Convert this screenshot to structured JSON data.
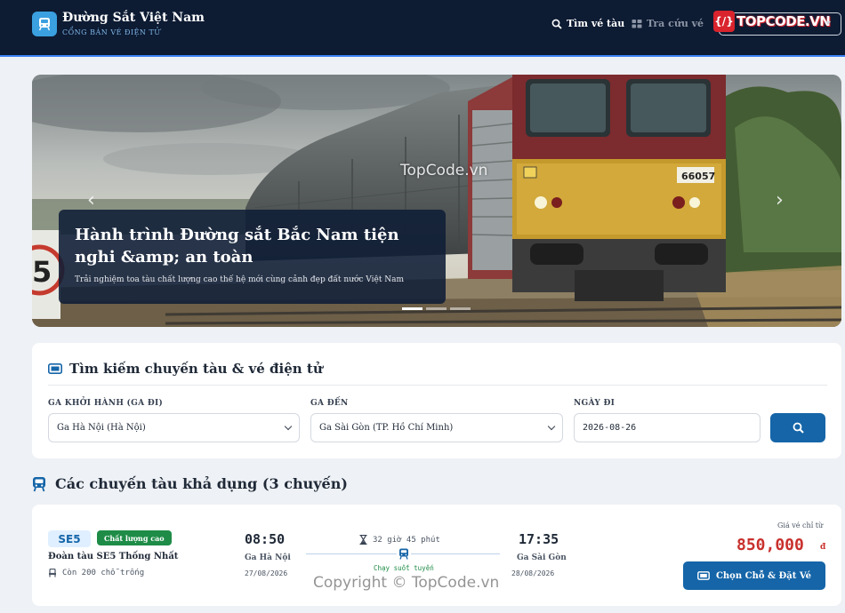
{
  "header": {
    "brand_name": "Đường Sắt Việt Nam",
    "brand_sub": "CỔNG BÁN VÉ ĐIỆN TỬ",
    "nav_search": "Tìm vé tàu",
    "nav_lookup": "Tra cứu vé",
    "watermark_logo_text": "TOPCODE.VN",
    "watermark_logo_mark": "{/}"
  },
  "hero": {
    "title": "Hành trình Đường sắt Bắc Nam tiện nghi &amp; an toàn",
    "subtitle": "Trải nghiệm toa tàu chất lượng cao thế hệ mới cùng cảnh đẹp đất nước Việt Nam",
    "prev_arrow": "‹",
    "next_arrow": "›",
    "locomotive_number": "66057",
    "watermark": "TopCode.vn",
    "slides": 3,
    "active_slide": 1
  },
  "search": {
    "title": "Tìm kiếm chuyến tàu & vé điện tử",
    "from_label": "GA KHỞI HÀNH (GA ĐI)",
    "from_value": "Ga Hà Nội (Hà Nội)",
    "to_label": "GA ĐẾN",
    "to_value": "Ga Sài Gòn (TP. Hồ Chí Minh)",
    "date_label": "NGÀY ĐI",
    "date_value": "2026-08-26"
  },
  "results": {
    "title": "Các chuyến tàu khả dụng (3 chuyến)",
    "trips": [
      {
        "code": "SE5",
        "quality": "Chất lượng cao",
        "name": "Đoàn tàu SE5 Thống Nhất",
        "seats": "Còn 200 chỗ trống",
        "depart_time": "08:50",
        "depart_station": "Ga Hà Nội",
        "depart_date": "27/08/2026",
        "duration": "32 giờ 45 phút",
        "route_note": "Chạy suốt tuyến",
        "arrive_time": "17:35",
        "arrive_station": "Ga Sài Gòn",
        "arrive_date": "28/08/2026",
        "price_label": "Giá vé chỉ từ",
        "price": "850,000",
        "currency": "đ",
        "book_label": "Chọn Chỗ & Đặt Vé"
      }
    ]
  },
  "footer": {
    "copyright": "Copyright © TopCode.vn"
  },
  "colors": {
    "header_bg": "#0d1b33",
    "accent": "#1565a8",
    "badge_green": "#1e8c47",
    "price_red": "#c9302c"
  }
}
